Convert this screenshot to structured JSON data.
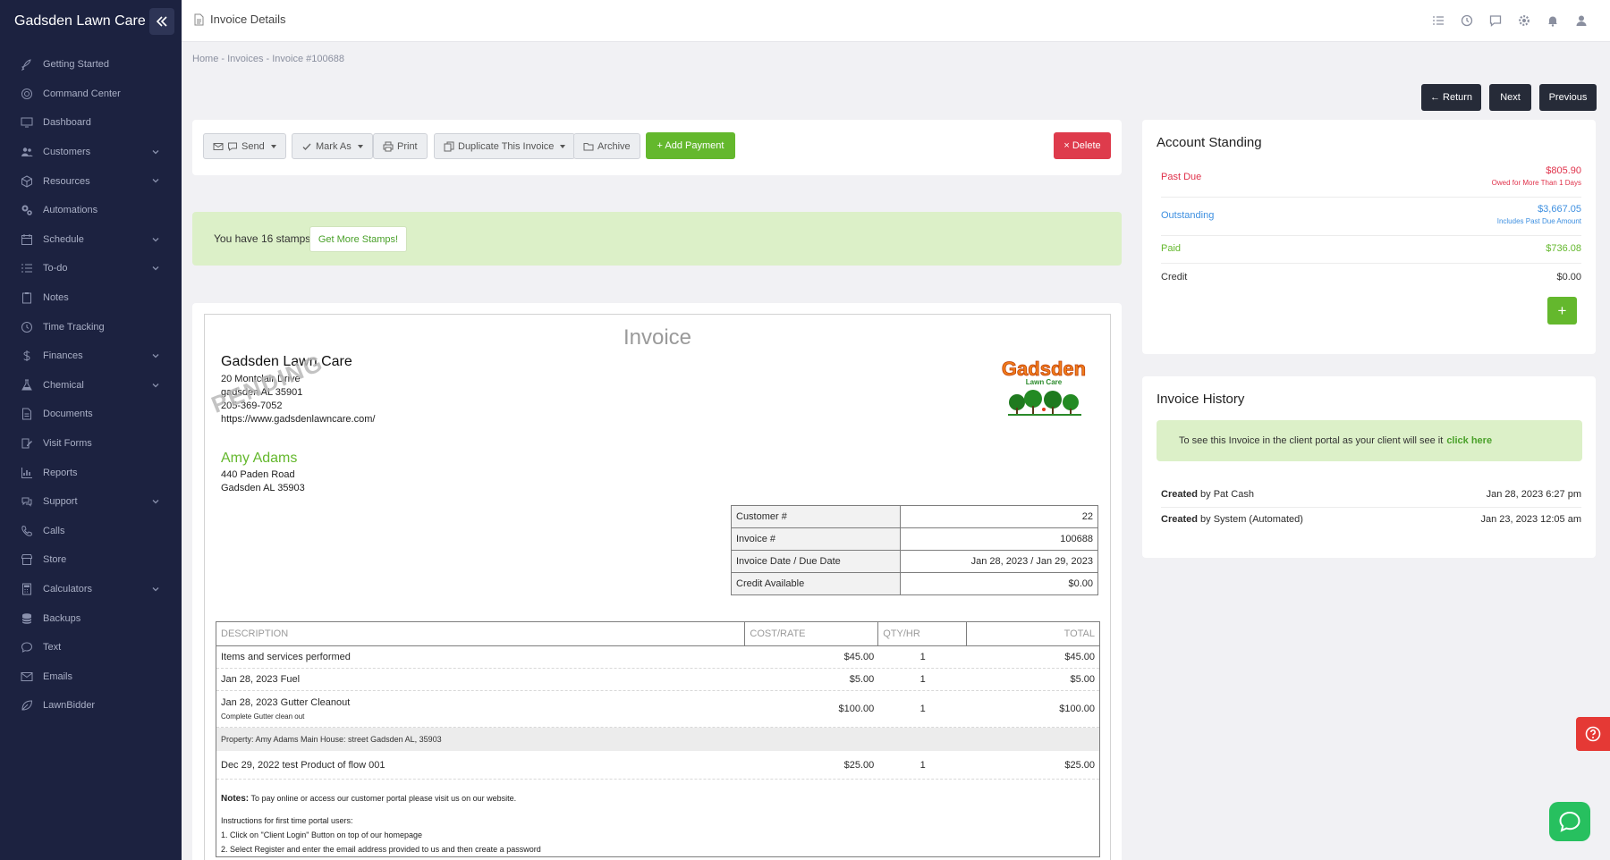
{
  "app": {
    "brand": "Gadsden Lawn Care",
    "page_title": "Invoice Details"
  },
  "sidebar": {
    "items": [
      {
        "label": "Getting Started",
        "icon": "rocket-icon",
        "expand": false
      },
      {
        "label": "Command Center",
        "icon": "target-icon",
        "expand": false
      },
      {
        "label": "Dashboard",
        "icon": "monitor-icon",
        "expand": false
      },
      {
        "label": "Customers",
        "icon": "users-icon",
        "expand": true
      },
      {
        "label": "Resources",
        "icon": "box-icon",
        "expand": true
      },
      {
        "label": "Automations",
        "icon": "gears-icon",
        "expand": false
      },
      {
        "label": "Schedule",
        "icon": "calendar-icon",
        "expand": true
      },
      {
        "label": "To-do",
        "icon": "list-icon",
        "expand": true
      },
      {
        "label": "Notes",
        "icon": "clipboard-icon",
        "expand": false
      },
      {
        "label": "Time Tracking",
        "icon": "clock-icon",
        "expand": false
      },
      {
        "label": "Finances",
        "icon": "dollar-icon",
        "expand": true
      },
      {
        "label": "Chemical",
        "icon": "flask-icon",
        "expand": true
      },
      {
        "label": "Documents",
        "icon": "document-icon",
        "expand": false
      },
      {
        "label": "Visit Forms",
        "icon": "form-icon",
        "expand": false
      },
      {
        "label": "Reports",
        "icon": "chart-icon",
        "expand": false
      },
      {
        "label": "Support",
        "icon": "chat-bubble-icon",
        "expand": true
      },
      {
        "label": "Calls",
        "icon": "phone-icon",
        "expand": false
      },
      {
        "label": "Store",
        "icon": "store-icon",
        "expand": false
      },
      {
        "label": "Calculators",
        "icon": "calculator-icon",
        "expand": true
      },
      {
        "label": "Backups",
        "icon": "database-icon",
        "expand": false
      },
      {
        "label": "Text",
        "icon": "message-icon",
        "expand": false
      },
      {
        "label": "Emails",
        "icon": "envelope-icon",
        "expand": false
      },
      {
        "label": "LawnBidder",
        "icon": "leaf-icon",
        "expand": false
      }
    ]
  },
  "breadcrumb": "Home  -  Invoices  -  Invoice #100688",
  "nav_buttons": {
    "return": "← Return",
    "next": "Next",
    "previous": "Previous"
  },
  "toolbar": {
    "send": "Send",
    "mark_as": "Mark As",
    "print": "Print",
    "duplicate": "Duplicate This Invoice",
    "archive": "Archive",
    "add_payment": "+ Add Payment",
    "delete": "× Delete"
  },
  "stamps": {
    "text": "You have 16 stamps.",
    "button": "Get More Stamps!"
  },
  "invoice": {
    "title": "Invoice",
    "watermark": "PENDING",
    "company": "Gadsden Lawn Care",
    "company_address": [
      "20 Montclair Drive",
      "gadsden AL 35901",
      "205-369-7052",
      "https://www.gadsdenlawncare.com/"
    ],
    "logo_text": "Gadsden",
    "logo_subtext": "Lawn Care",
    "client": "Amy Adams",
    "client_address": [
      "440 Paden Road",
      "Gadsden AL 35903"
    ],
    "meta": [
      {
        "k": "Customer #",
        "v": "22"
      },
      {
        "k": "Invoice #",
        "v": "100688"
      },
      {
        "k": "Invoice Date / Due Date",
        "v": "Jan 28, 2023 / Jan 29, 2023"
      },
      {
        "k": "Credit Available",
        "v": "$0.00"
      }
    ],
    "columns": [
      "DESCRIPTION",
      "COST/RATE",
      "QTY/HR",
      "TOTAL"
    ],
    "rows": [
      {
        "desc": "Items and services performed",
        "sub": "",
        "rate": "$45.00",
        "qty": "1",
        "total": "$45.00"
      },
      {
        "desc": "Jan 28, 2023 Fuel",
        "sub": "",
        "rate": "$5.00",
        "qty": "1",
        "total": "$5.00"
      },
      {
        "desc": "Jan 28, 2023 Gutter Cleanout",
        "sub": "Complete Gutter clean out",
        "rate": "$100.00",
        "qty": "1",
        "total": "$100.00"
      }
    ],
    "property": "Property: Amy Adams Main House: street Gadsden AL, 35903",
    "rows2": [
      {
        "desc": "Dec 29, 2022 test Product of flow 001",
        "sub": "",
        "rate": "$25.00",
        "qty": "1",
        "total": "$25.00"
      }
    ],
    "notes_label": "Notes:",
    "notes_text": "To pay online or access our customer portal please visit us on our website.",
    "instructions": [
      "Instructions for first time portal users:",
      "1. Click on \"Client Login\" Button on top of our homepage",
      "2. Select Register and enter the email address provided to us and then create a password"
    ]
  },
  "standing": {
    "title": "Account Standing",
    "rows": [
      {
        "label": "Past Due",
        "value": "$805.90",
        "sub": "Owed for More Than 1 Days",
        "color": "#e0324b"
      },
      {
        "label": "Outstanding",
        "value": "$3,667.05",
        "sub": "Includes Past Due Amount",
        "color": "#3d8fe0"
      },
      {
        "label": "Paid",
        "value": "$736.08",
        "sub": "",
        "color": "#64b82d"
      },
      {
        "label": "Credit",
        "value": "$0.00",
        "sub": "",
        "color": "#333333"
      }
    ],
    "plus": "+"
  },
  "history": {
    "title": "Invoice History",
    "banner_text": "To see this Invoice in the client portal as your client will see it",
    "banner_link": "click here",
    "rows": [
      {
        "bold": "Created",
        "by": " by Pat Cash",
        "date": "Jan 28, 2023 6:27 pm"
      },
      {
        "bold": "Created",
        "by": " by System (Automated)",
        "date": "Jan 23, 2023 12:05 am"
      }
    ]
  },
  "colors": {
    "sidebar": "#1c2240",
    "green": "#64b82d",
    "red": "#de3b4c",
    "dark": "#262b38"
  }
}
